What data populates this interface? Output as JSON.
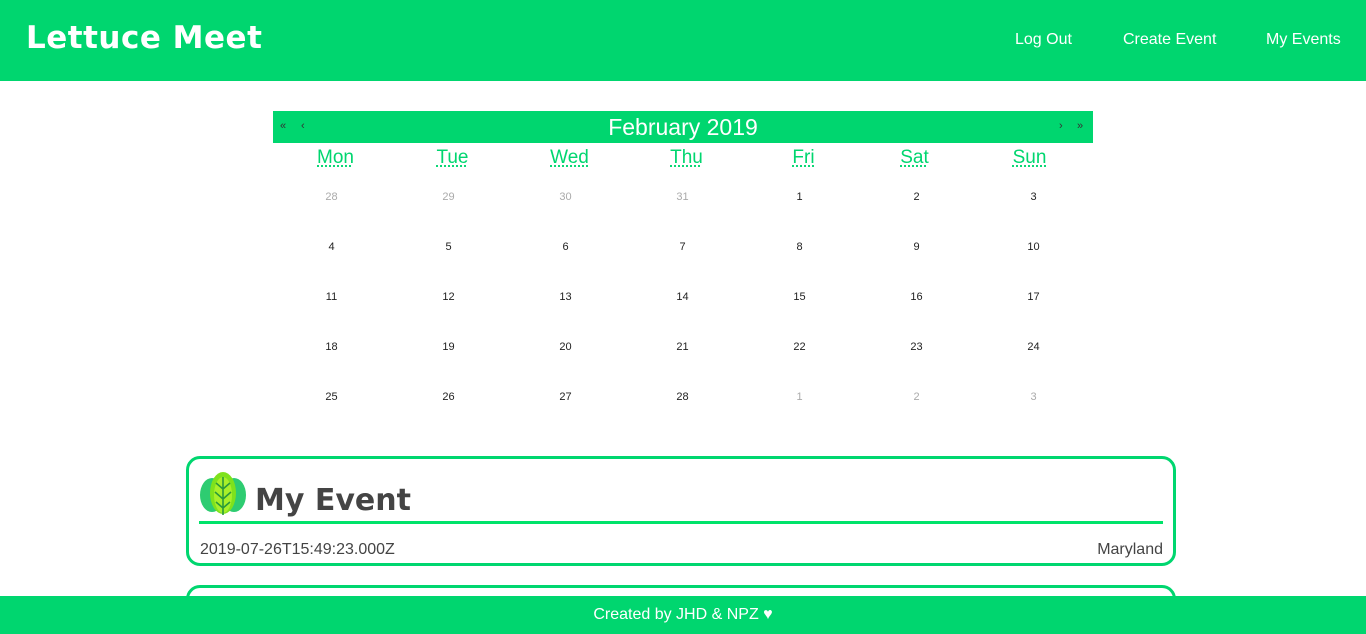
{
  "nav": {
    "brand": "Lettuce Meet",
    "links": [
      "Log Out",
      "Create Event",
      "My Events"
    ]
  },
  "calendar": {
    "month_label": "February 2019",
    "prev_year": "«",
    "prev_month": "‹",
    "next_month": "›",
    "next_year": "»",
    "weekdays": [
      "Mon",
      "Tue",
      "Wed",
      "Thu",
      "Fri",
      "Sat",
      "Sun"
    ],
    "weeks": [
      [
        {
          "d": "28",
          "muted": true
        },
        {
          "d": "29",
          "muted": true
        },
        {
          "d": "30",
          "muted": true
        },
        {
          "d": "31",
          "muted": true
        },
        {
          "d": "1"
        },
        {
          "d": "2"
        },
        {
          "d": "3"
        }
      ],
      [
        {
          "d": "4"
        },
        {
          "d": "5"
        },
        {
          "d": "6"
        },
        {
          "d": "7"
        },
        {
          "d": "8"
        },
        {
          "d": "9"
        },
        {
          "d": "10"
        }
      ],
      [
        {
          "d": "11"
        },
        {
          "d": "12"
        },
        {
          "d": "13"
        },
        {
          "d": "14"
        },
        {
          "d": "15"
        },
        {
          "d": "16"
        },
        {
          "d": "17"
        }
      ],
      [
        {
          "d": "18"
        },
        {
          "d": "19"
        },
        {
          "d": "20"
        },
        {
          "d": "21"
        },
        {
          "d": "22"
        },
        {
          "d": "23"
        },
        {
          "d": "24"
        }
      ],
      [
        {
          "d": "25"
        },
        {
          "d": "26"
        },
        {
          "d": "27"
        },
        {
          "d": "28"
        },
        {
          "d": "1",
          "muted": true
        },
        {
          "d": "2",
          "muted": true
        },
        {
          "d": "3",
          "muted": true
        }
      ]
    ]
  },
  "event": {
    "icon": "lettuce-icon",
    "title": "My Event",
    "datetime": "2019-07-26T15:49:23.000Z",
    "location": "Maryland"
  },
  "footer": {
    "text": "Created by JHD & NPZ ♥"
  },
  "colors": {
    "accent": "#00d66f"
  }
}
